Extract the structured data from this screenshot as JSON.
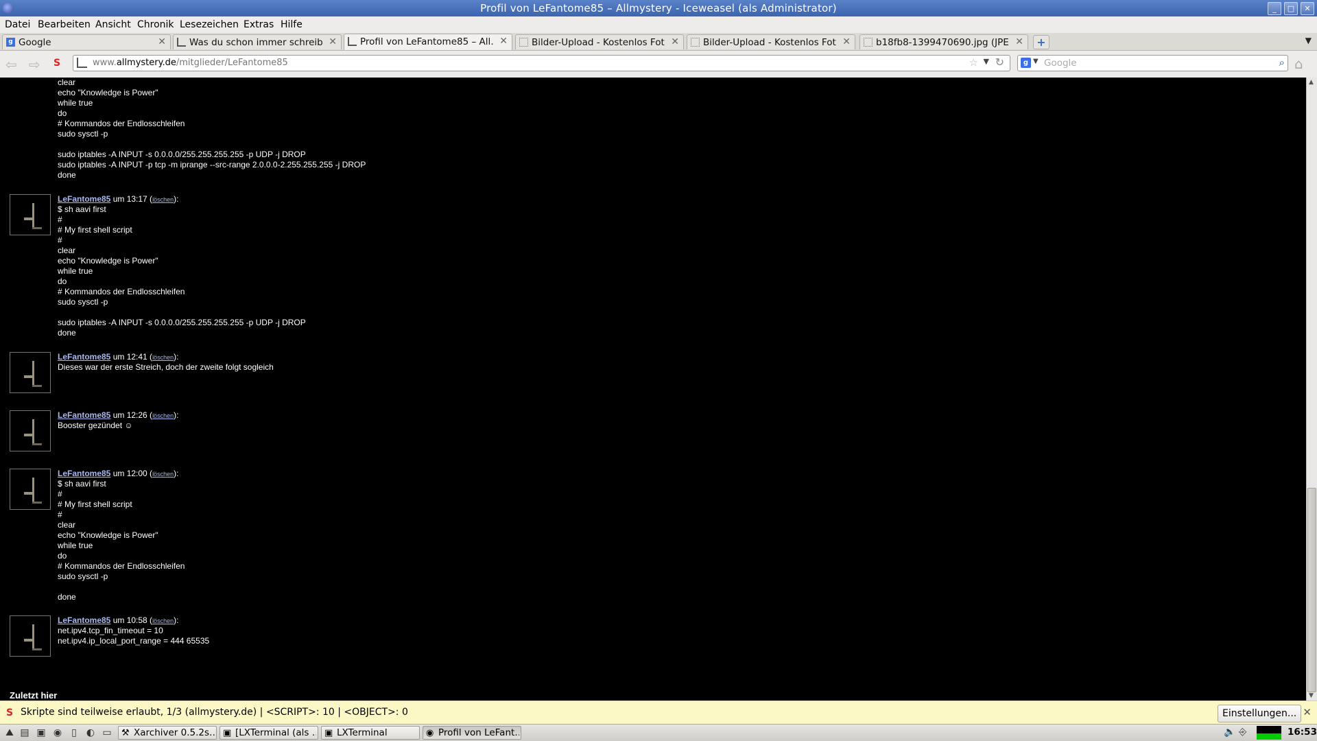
{
  "window": {
    "title": "Profil von LeFantome85 – Allmystery - Iceweasel (als Administrator)",
    "controls": [
      "minimize",
      "maximize",
      "close"
    ]
  },
  "menubar": [
    "Datei",
    "Bearbeiten",
    "Ansicht",
    "Chronik",
    "Lesezeichen",
    "Extras",
    "Hilfe"
  ],
  "tabs": [
    {
      "label": "Google",
      "active": false
    },
    {
      "label": "Was du schon immer schreib…",
      "active": false
    },
    {
      "label": "Profil von LeFantome85 – All…",
      "active": true
    },
    {
      "label": "Bilder-Upload - Kostenlos Fot…",
      "active": false
    },
    {
      "label": "Bilder-Upload - Kostenlos Fot…",
      "active": false
    },
    {
      "label": "b18fb8-1399470690.jpg (JPE…",
      "active": false
    }
  ],
  "urlbar": {
    "host": "www.",
    "domain": "allmystery.de",
    "path": "/mitglieder/LeFantome85"
  },
  "search": {
    "placeholder": "Google"
  },
  "content": {
    "top_fragment": "clear\necho \"Knowledge is Power\"\nwhile true\ndo\n# Kommandos der Endlosschleifen\nsudo sysctl -p\n\nsudo iptables -A INPUT -s 0.0.0.0/255.255.255.255 -p UDP -j DROP\nsudo iptables -A INPUT -p tcp -m iprange --src-range 2.0.0.0-2.255.255.255 -j DROP\ndone",
    "posts": [
      {
        "user": "LeFantome85",
        "time": " um 13:17 (",
        "delete": "löschen",
        "after": "):",
        "body": "$ sh aavi first\n#\n# My first shell script\n#\nclear\necho \"Knowledge is Power\"\nwhile true\ndo\n# Kommandos der Endlosschleifen\nsudo sysctl -p\n\nsudo iptables -A INPUT -s 0.0.0.0/255.255.255.255 -p UDP -j DROP\ndone"
      },
      {
        "user": "LeFantome85",
        "time": " um 12:41 (",
        "delete": "löschen",
        "after": "):",
        "body": "Dieses war der erste Streich, doch der zweite folgt sogleich"
      },
      {
        "user": "LeFantome85",
        "time": " um 12:26 (",
        "delete": "löschen",
        "after": "):",
        "body": "Booster gezündet ☺"
      },
      {
        "user": "LeFantome85",
        "time": " um 12:00 (",
        "delete": "löschen",
        "after": "):",
        "body": "$ sh aavi first\n#\n# My first shell script\n#\nclear\necho \"Knowledge is Power\"\nwhile true\ndo\n# Kommandos der Endlosschleifen\nsudo sysctl -p\n\ndone"
      },
      {
        "user": "LeFantome85",
        "time": " um 10:58 (",
        "delete": "löschen",
        "after": "):",
        "body": "net.ipv4.tcp_fin_timeout = 10\nnet.ipv4.ip_local_port_range = 444 65535"
      }
    ],
    "section_heading": "Zuletzt hier"
  },
  "notification": {
    "text": "Skripte sind teilweise erlaubt, 1/3 (allmystery.de) | <SCRIPT>: 10 | <OBJECT>: 0",
    "button": "Einstellungen..."
  },
  "taskbar": {
    "tasks": [
      {
        "label": "Xarchiver 0.5.2s…",
        "active": false
      },
      {
        "label": "[LXTerminal (als …",
        "active": false
      },
      {
        "label": "LXTerminal",
        "active": false
      },
      {
        "label": "Profil von LeFant…",
        "active": true
      }
    ],
    "clock": "16:53"
  },
  "colors": {
    "titlebar": "#4a72bc",
    "link": "#aab8ee",
    "notification": "#fbf8c6",
    "page_bg": "#000000"
  }
}
